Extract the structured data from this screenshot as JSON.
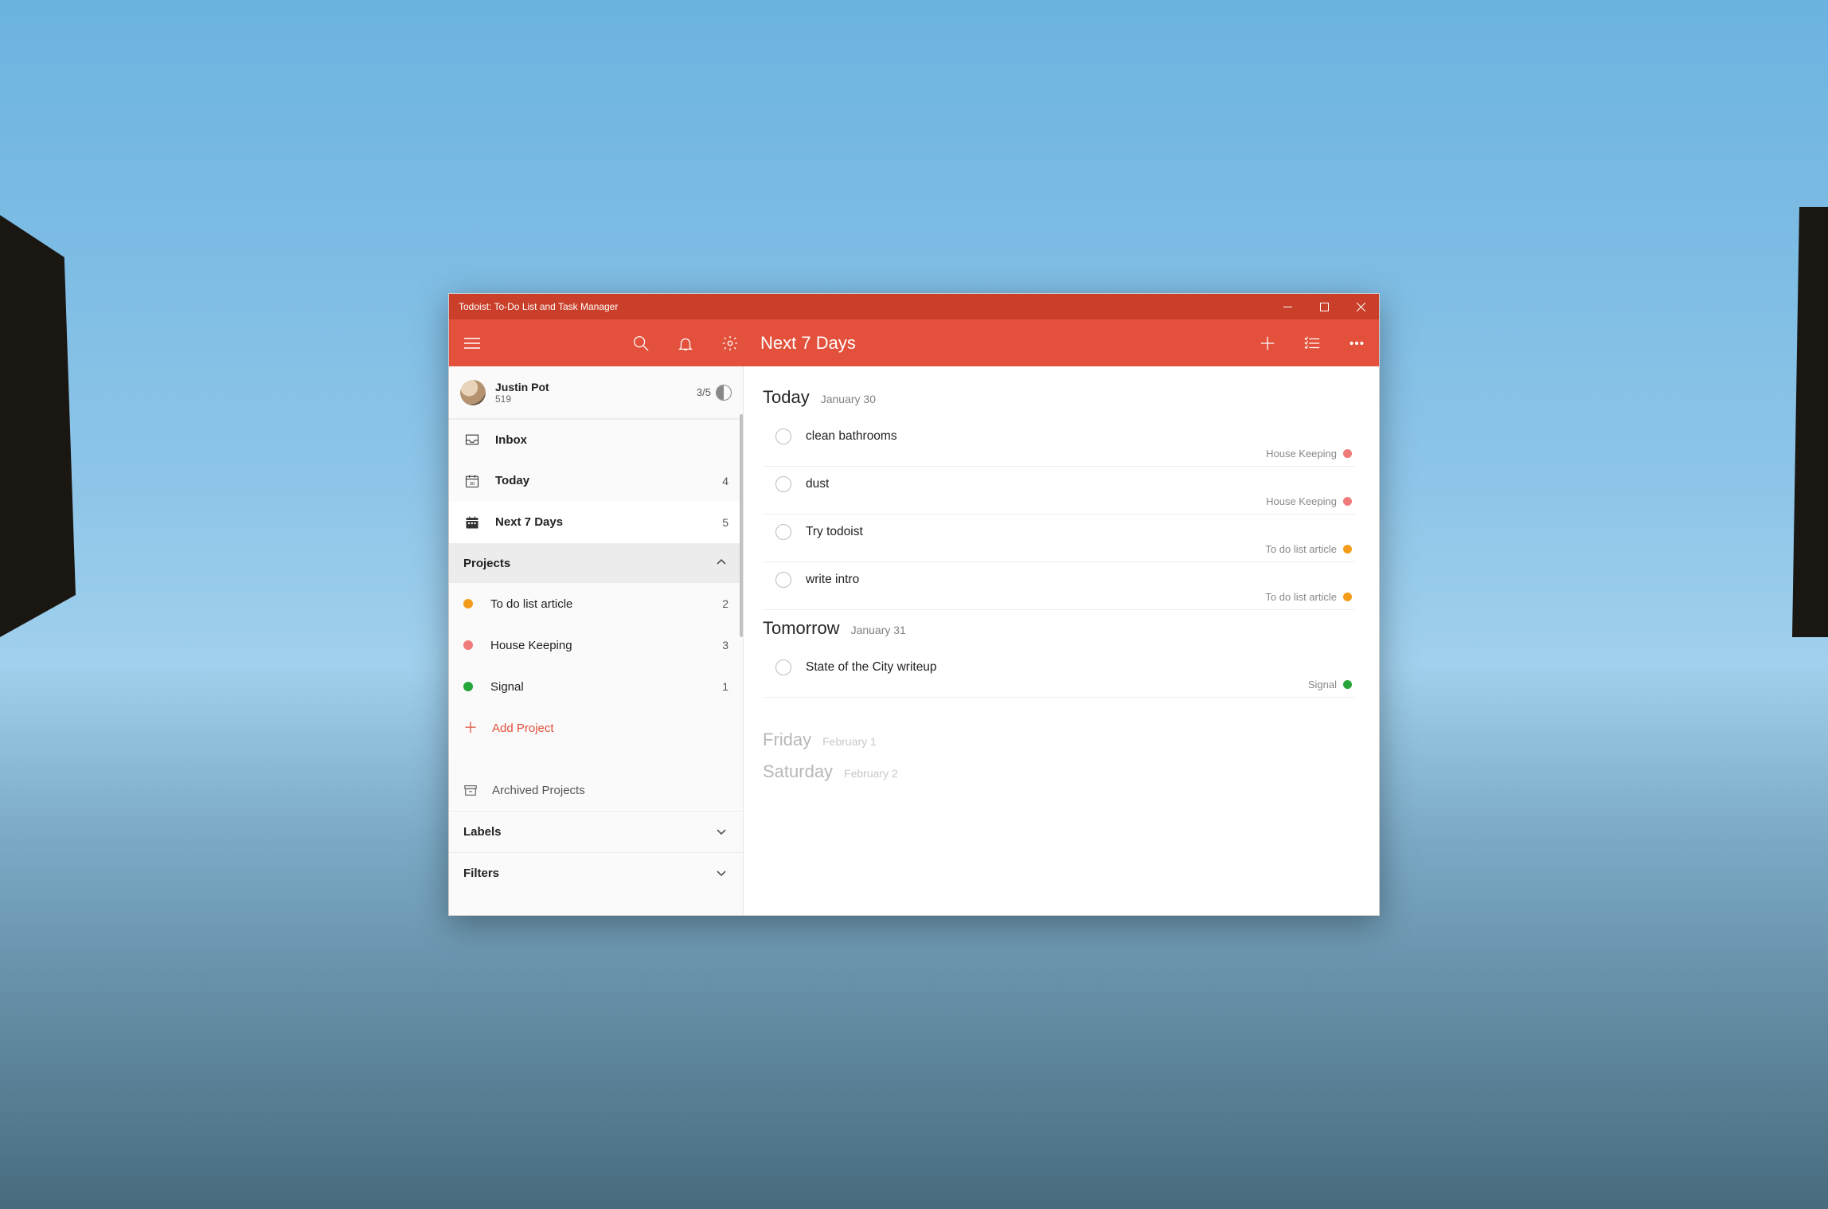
{
  "window": {
    "title": "Todoist: To-Do List and Task Manager"
  },
  "toolbar": {
    "view_title": "Next 7 Days"
  },
  "user": {
    "name": "Justin Pot",
    "karma_points": "519",
    "daily_progress": "3/5"
  },
  "sidebar": {
    "nav": [
      {
        "label": "Inbox",
        "count": ""
      },
      {
        "label": "Today",
        "count": "4"
      },
      {
        "label": "Next 7 Days",
        "count": "5"
      }
    ],
    "projects_header": "Projects",
    "projects": [
      {
        "label": "To do list article",
        "count": "2",
        "color": "#f49c1a"
      },
      {
        "label": "House Keeping",
        "count": "3",
        "color": "#f07b7b"
      },
      {
        "label": "Signal",
        "count": "1",
        "color": "#26a53a"
      }
    ],
    "add_project_label": "Add Project",
    "archived_label": "Archived Projects",
    "labels_header": "Labels",
    "filters_header": "Filters"
  },
  "days": [
    {
      "name": "Today",
      "date": "January 30",
      "faded": false,
      "tasks": [
        {
          "title": "clean bathrooms",
          "project": "House Keeping",
          "color": "#f07b7b"
        },
        {
          "title": "dust",
          "project": "House Keeping",
          "color": "#f07b7b"
        },
        {
          "title": "Try todoist",
          "project": "To do list article",
          "color": "#f49c1a"
        },
        {
          "title": "write intro",
          "project": "To do list article",
          "color": "#f49c1a"
        }
      ]
    },
    {
      "name": "Tomorrow",
      "date": "January 31",
      "faded": false,
      "tasks": [
        {
          "title": "State of the City writeup",
          "project": "Signal",
          "color": "#26a53a"
        }
      ]
    },
    {
      "name": "Friday",
      "date": "February 1",
      "faded": true,
      "tasks": []
    },
    {
      "name": "Saturday",
      "date": "February 2",
      "faded": true,
      "tasks": []
    }
  ]
}
